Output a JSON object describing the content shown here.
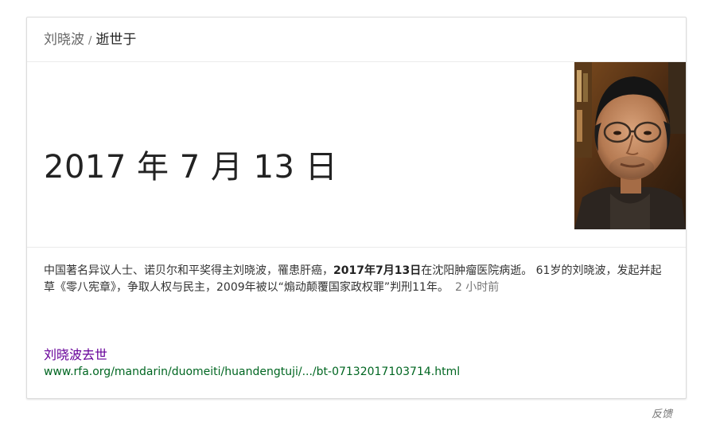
{
  "header": {
    "subject": "刘晓波",
    "separator": "/",
    "attribute": "逝世于"
  },
  "answer": {
    "date": "2017 年 7 月 13 日"
  },
  "photo": {
    "icon": "portrait-photo"
  },
  "snippet": {
    "part1": "中国著名异议人士、诺贝尔和平奖得主刘晓波，罹患肝癌，",
    "bold": "2017年7月13日",
    "part2": "在沈阳肿瘤医院病逝。 61岁的刘晓波，发起并起草《零八宪章》，争取人权与民主，2009年被以“煽动颠覆国家政权罪”判刑11年。",
    "time_ago": "2 小时前"
  },
  "source": {
    "title": "刘晓波去世",
    "url": "www.rfa.org/mandarin/duomeiti/huandengtuji/.../bt-07132017103714.html"
  },
  "footer": {
    "feedback": "反馈"
  },
  "colors": {
    "link_visited": "#660099",
    "url_green": "#006621",
    "muted": "#777777"
  }
}
